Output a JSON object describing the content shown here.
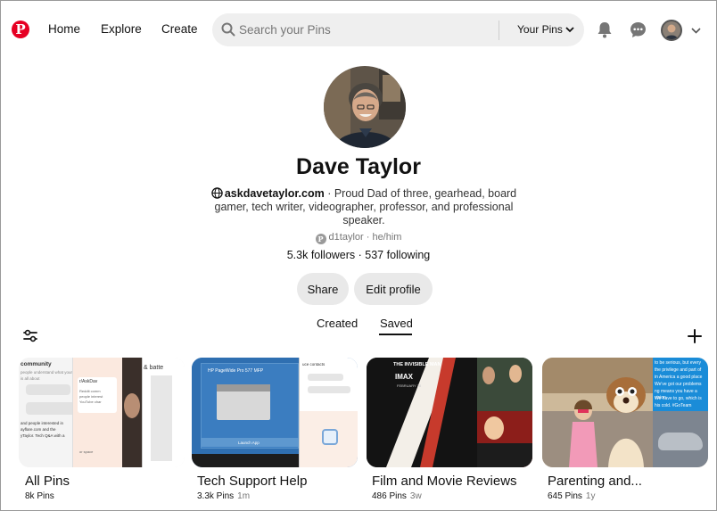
{
  "nav": {
    "links": [
      "Home",
      "Explore",
      "Create"
    ],
    "search_placeholder": "Search your Pins",
    "search_scope": "Your Pins",
    "brand_color": "#e60023"
  },
  "profile": {
    "name": "Dave Taylor",
    "website": "askdavetaylor.com",
    "bio": " · Proud Dad of three, gearhead, board gamer, tech writer, videographer, professor, and professional speaker.",
    "username": "d1taylor",
    "pronouns": " · he/him",
    "followers": "5.3k followers",
    "following": "537 following",
    "share_label": "Share",
    "edit_label": "Edit profile"
  },
  "tabs": [
    {
      "label": "Created",
      "active": false
    },
    {
      "label": "Saved",
      "active": true
    }
  ],
  "boards": [
    {
      "title": "All Pins",
      "pins": "8k Pins",
      "age": "",
      "thumb_text": [
        "community",
        "people understand what your community is all about",
        "r/AskDav",
        "& batte",
        "Reddit comm",
        "people interest",
        "YouTube char",
        "and people interested in",
        "ayflare.com and the",
        "yTaylor. Tech Q&A with a",
        "or space"
      ]
    },
    {
      "title": "Tech Support Help",
      "pins": "3.3k Pins",
      "age": "1m",
      "thumb_text": [
        "HP PageWide Pro 577 MFP",
        "Launch App",
        "uce contacts"
      ]
    },
    {
      "title": "Film and Movie Reviews",
      "pins": "486 Pins",
      "age": "3w",
      "thumb_text": [
        "THE INVISIBLE MAN",
        "IMAX",
        "FEBRUARY 28"
      ]
    },
    {
      "title": "Parenting and...",
      "pins": "645 Pins",
      "age": "1y",
      "thumb_text": [
        "to be serious, but every",
        "the privilege and part of",
        "in America a good place",
        "We've got our problems",
        "ng means you have a vision",
        "We have to go, which is",
        "his cold. #GoTeam"
      ]
    }
  ]
}
